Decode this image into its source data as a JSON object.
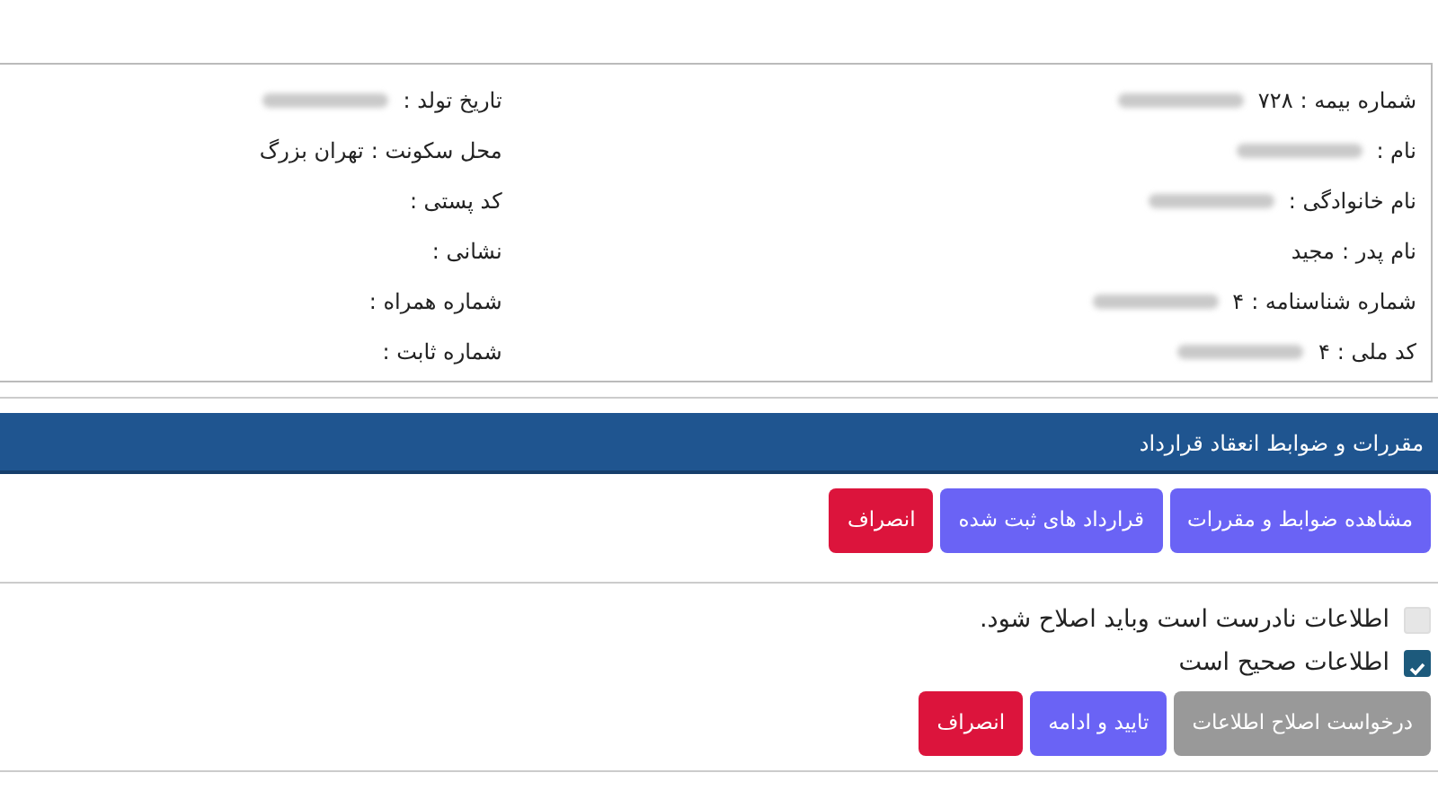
{
  "info_columns": [
    [
      {
        "label": "شماره بیمه :",
        "value": "۷۲۸",
        "redacted": true
      },
      {
        "label": "نام :",
        "redacted": true
      },
      {
        "label": "نام خانوادگی :",
        "redacted": true
      },
      {
        "label": "نام پدر :",
        "value": "مجید"
      },
      {
        "label": "شماره شناسنامه :",
        "value": "۴",
        "redacted": true
      },
      {
        "label": "کد ملی :",
        "value": "۴",
        "redacted": true
      }
    ],
    [
      {
        "label": "تاریخ تولد :",
        "redacted": true
      },
      {
        "label": "محل سکونت :",
        "value": "تهران بزرگ"
      },
      {
        "label": "کد پستی :"
      },
      {
        "label": "نشانی :"
      },
      {
        "label": "شماره همراه :"
      },
      {
        "label": "شماره ثابت :"
      }
    ]
  ],
  "contract_section": {
    "title": "مقررات و ضوابط انعقاد قرارداد",
    "buttons": [
      {
        "label": "مشاهده ضوابط و مقررات",
        "kind": "primary"
      },
      {
        "label": "قرارداد های ثبت شده",
        "kind": "primary"
      },
      {
        "label": "انصراف",
        "kind": "danger"
      }
    ]
  },
  "confirmations": [
    {
      "label": "اطلاعات نادرست است وباید اصلاح شود.",
      "checked": false
    },
    {
      "label": "اطلاعات صحیح است",
      "checked": true
    }
  ],
  "action_buttons": [
    {
      "label": "درخواست اصلاح اطلاعات",
      "kind": "disabled"
    },
    {
      "label": "تایید و ادامه",
      "kind": "primary"
    },
    {
      "label": "انصراف",
      "kind": "danger"
    }
  ]
}
